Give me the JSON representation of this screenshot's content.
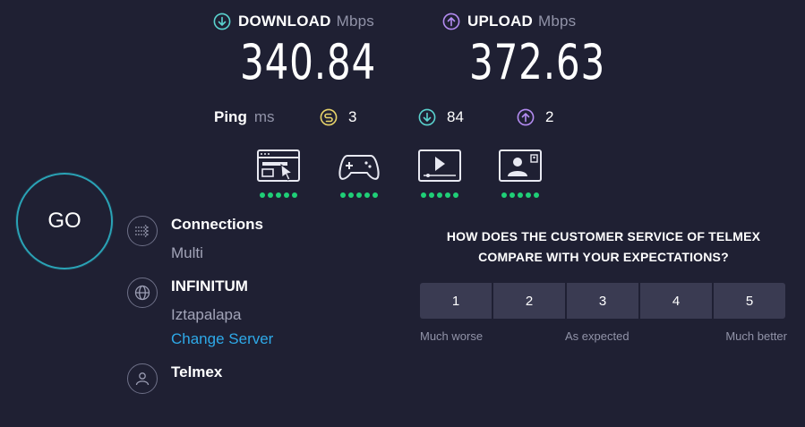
{
  "download": {
    "label": "DOWNLOAD",
    "unit": "Mbps",
    "value": "340.84",
    "icon": "download-arrow-icon",
    "color": "#5ad3cf"
  },
  "upload": {
    "label": "UPLOAD",
    "unit": "Mbps",
    "value": "372.63",
    "icon": "upload-arrow-icon",
    "color": "#b48cf2"
  },
  "ping": {
    "label": "Ping",
    "unit": "ms",
    "idle": {
      "value": "3",
      "icon": "idle-latency-icon",
      "color": "#e8d46a"
    },
    "download": {
      "value": "84",
      "icon": "download-latency-icon",
      "color": "#5ad3cf"
    },
    "upload": {
      "value": "2",
      "icon": "upload-latency-icon",
      "color": "#b48cf2"
    }
  },
  "experience": [
    {
      "icon": "web-browsing-icon",
      "rating": 5
    },
    {
      "icon": "gaming-icon",
      "rating": 5
    },
    {
      "icon": "video-streaming-icon",
      "rating": 5
    },
    {
      "icon": "video-chat-icon",
      "rating": 5
    }
  ],
  "go_button": {
    "label": "GO"
  },
  "connections": {
    "title": "Connections",
    "value": "Multi",
    "icon": "connections-icon"
  },
  "server": {
    "title": "INFINITUM",
    "location": "Iztapalapa",
    "change_link": "Change Server",
    "icon": "globe-icon"
  },
  "provider": {
    "title": "Telmex",
    "icon": "user-icon"
  },
  "survey": {
    "question_line1": "HOW DOES THE CUSTOMER SERVICE OF TELMEX",
    "question_line2": "COMPARE WITH YOUR EXPECTATIONS?",
    "options": [
      "1",
      "2",
      "3",
      "4",
      "5"
    ],
    "scale_low": "Much worse",
    "scale_mid": "As expected",
    "scale_high": "Much better"
  },
  "colors": {
    "background": "#1f2033",
    "accent_ring": "#2aa3b6",
    "good": "#1fcf77",
    "link": "#2ea9e8"
  }
}
